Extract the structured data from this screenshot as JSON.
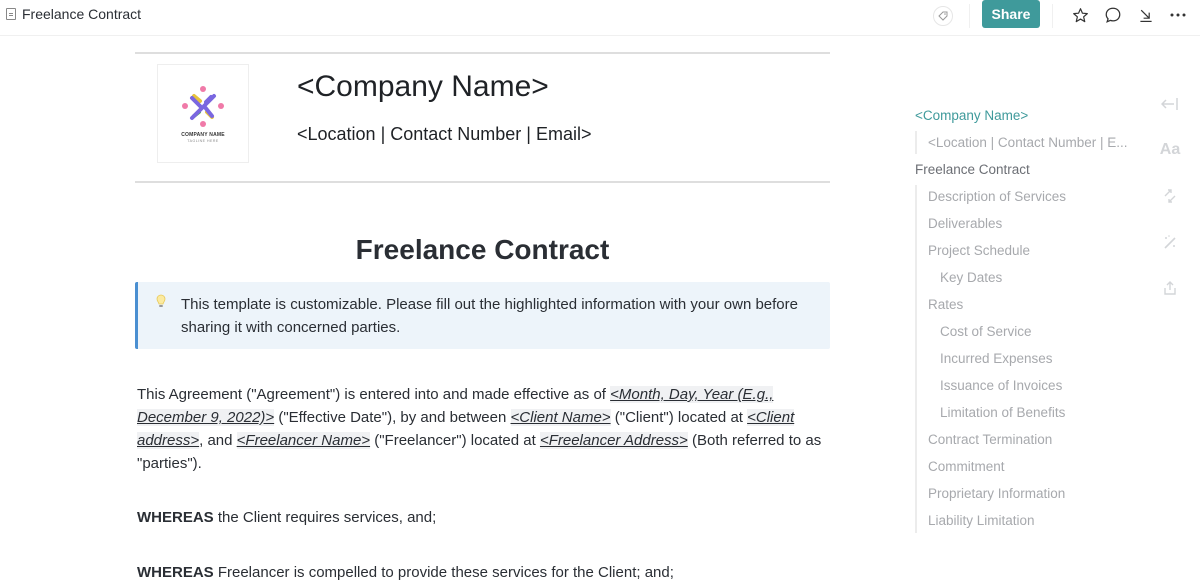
{
  "topbar": {
    "doc_title": "Freelance Contract",
    "share_label": "Share",
    "icons": [
      "tag-icon",
      "star-icon",
      "comment-icon",
      "download-icon",
      "more-icon"
    ],
    "share_color": "#3f9a9b"
  },
  "header": {
    "logo_caption": "COMPANY NAME",
    "logo_tagline": "TAGLINE HERE",
    "company_name": "<Company Name>",
    "contact": "<Location | Contact Number | Email>"
  },
  "document": {
    "title": "Freelance Contract",
    "callout": "This template is customizable. Please fill out the highlighted information with your own before sharing it with concerned parties.",
    "intro": {
      "t1": "This Agreement (\"Agreement\") is entered into and made effective as of ",
      "p1": "<Month, Day, Year (E.g., December 9, 2022)>",
      "t2": " (\"Effective Date\"), by and between ",
      "p2": "<Client Name>",
      "t3": " (\"Client\") located at ",
      "p3": "<Client address>",
      "t4": ", and ",
      "p4": "<Freelancer Name>",
      "t5": " (\"Freelancer\") located at ",
      "p5": "<Freelancer Address>",
      "t6": " (Both referred to as \"parties\")."
    },
    "whereas1": {
      "bold": "WHEREAS",
      "text": " the Client requires services, and;"
    },
    "whereas2": {
      "bold": "WHEREAS",
      "text": " Freelancer is compelled to provide these services for the Client; and;"
    }
  },
  "toc": {
    "items": [
      {
        "label": "<Company Name>",
        "level": 1,
        "active": true
      },
      {
        "label": "<Location | Contact Number | E...",
        "level": 2
      },
      {
        "label": "Freelance Contract",
        "level": 1
      },
      {
        "label": "Description of Services",
        "level": 2
      },
      {
        "label": "Deliverables",
        "level": 2
      },
      {
        "label": "Project Schedule",
        "level": 2
      },
      {
        "label": "Key Dates",
        "level": 3
      },
      {
        "label": "Rates",
        "level": 2
      },
      {
        "label": "Cost of Service",
        "level": 3
      },
      {
        "label": "Incurred Expenses",
        "level": 3
      },
      {
        "label": "Issuance of Invoices",
        "level": 3
      },
      {
        "label": "Limitation of Benefits",
        "level": 3
      },
      {
        "label": "Contract Termination",
        "level": 2
      },
      {
        "label": "Commitment",
        "level": 2
      },
      {
        "label": "Proprietary Information",
        "level": 2
      },
      {
        "label": "Liability Limitation",
        "level": 2
      }
    ]
  },
  "side_tools": {
    "icons": [
      "collapse-icon",
      "font-icon",
      "swap-icon",
      "magic-wand-icon",
      "export-icon"
    ],
    "font_label": "Aa"
  }
}
